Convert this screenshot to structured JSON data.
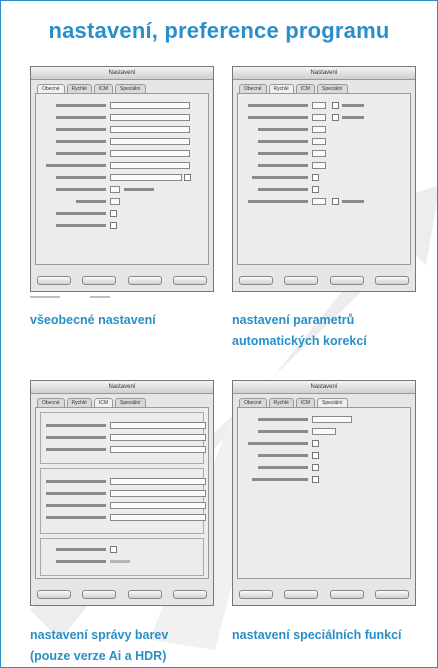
{
  "title": "nastavení, preference programu",
  "screenshots": [
    {
      "window_title": "Nastavení",
      "tabs": [
        "Obecné",
        "Rychlé",
        "ICM",
        "Speciální"
      ],
      "active_tab": 0
    },
    {
      "window_title": "Nastavení",
      "tabs": [
        "Obecné",
        "Rychlé",
        "ICM",
        "Speciální"
      ],
      "active_tab": 1
    },
    {
      "window_title": "Nastavení",
      "tabs": [
        "Obecné",
        "Rychlé",
        "ICM",
        "Speciální"
      ],
      "active_tab": 2
    },
    {
      "window_title": "Nastavení",
      "tabs": [
        "Obecné",
        "Rychlé",
        "ICM",
        "Speciální"
      ],
      "active_tab": 3
    }
  ],
  "captions": {
    "c1": "všeobecné nastavení",
    "c2_l1": "nastavení parametrů",
    "c2_l2": "automatických korekcí",
    "c3_l1": "nastavení správy barev",
    "c3_l2": "(pouze verze Ai a HDR)",
    "c4": "nastavení speciálních funkcí"
  },
  "colors": {
    "accent": "#2a8fc8",
    "watermark": "#ececec"
  }
}
